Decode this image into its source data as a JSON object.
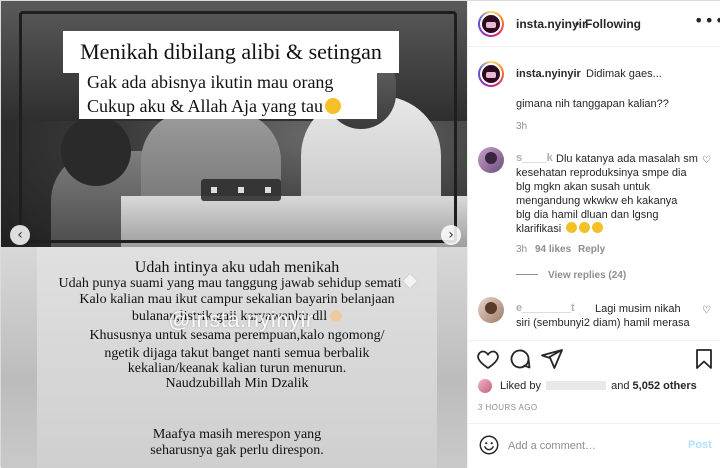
{
  "media": {
    "image_title": "Menikah dibilang alibi & setingan",
    "image_subtitle_line1": "Gak ada abisnya ikutin mau orang",
    "image_subtitle_line2": "Cukup aku & Allah Aja yang tau",
    "watermark": "@insta.nyinyir",
    "caption_lines": [
      "Udah intinya aku udah menikah",
      "Udah punya suami yang mau tanggung  jawab sehidup semati",
      "Kalo kalian mau ikut campur sekalian bayarin belanjaan",
      "bulanan,listrik,gaji karyawanku dll",
      "Khususnya untuk sesama perempuan,kalo ngomong/",
      "ngetik dijaga takut banget nanti semua berbalik",
      "kekalian/keanak kalian turun menurun.",
      "Naudzubillah Min Dzalik",
      "Maafya masih merespon yang",
      "seharusnya gak perlu direspon."
    ],
    "prev_icon": "chevron-left-icon",
    "next_icon": "chevron-right-icon"
  },
  "header": {
    "username": "insta.nyinyir",
    "separator": "•",
    "follow_label": "Following",
    "more_icon": "more-icon"
  },
  "caption": {
    "username": "insta.nyinyir",
    "text": "Didimak gaes...",
    "text2": "gimana nih tanggapan kalian??",
    "time": "3h"
  },
  "comments": [
    {
      "username": "s____k",
      "lines": [
        "Dlu katanya ada masalah sm",
        "kesehatan reproduksinya smpe dia",
        "blg mgkn akan susah untuk",
        "mengandung wkwkw eh kakanya",
        "blg dia hamil dluan dan lgsng",
        "klarifikasi"
      ],
      "time": "3h",
      "likes": "94 likes",
      "reply": "Reply",
      "view_replies": "View replies (24)"
    },
    {
      "username": "e________t",
      "lines": [
        "Lagi musim nikah",
        "siri (sembunyi2 diam) hamil merasa",
        "_________________________________"
      ]
    }
  ],
  "actions": {
    "liked_by_prefix": "Liked by",
    "liked_by_suffix": "and",
    "likes_count": "5,052 others",
    "timestamp": "3 HOURS AGO"
  },
  "comment_box": {
    "placeholder": "Add a comment…",
    "post_label": "Post"
  },
  "colors": {
    "link_blue_disabled": "#b2dffc",
    "secondary_text": "#8e8e8e",
    "border": "#efefef"
  }
}
